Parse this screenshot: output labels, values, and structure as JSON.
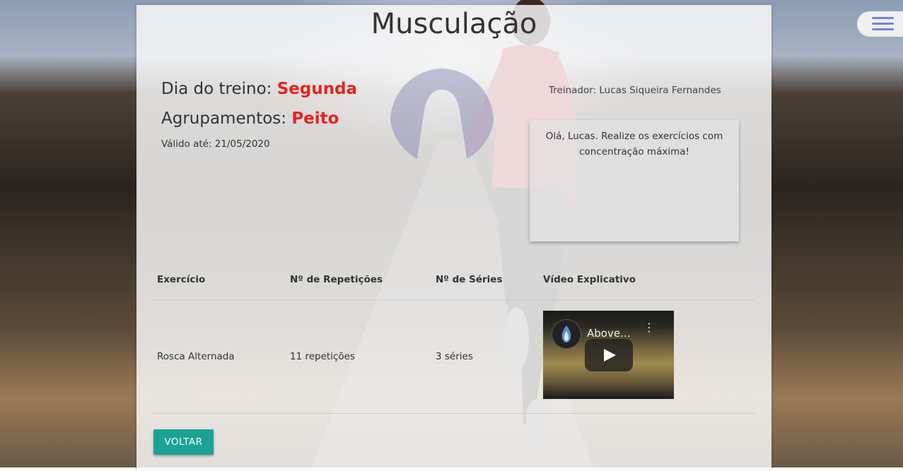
{
  "page": {
    "title": "Musculação"
  },
  "workout": {
    "day_label": "Dia do treino:",
    "day_value": "Segunda",
    "group_label": "Agrupamentos:",
    "group_value": "Peito",
    "valid_until": "Válido até: 21/05/2020"
  },
  "trainer": {
    "text": "Treinador: Lucas Siqueira Fernandes",
    "message": "Olá, Lucas. Realize os exercícios com concentração máxima!"
  },
  "table": {
    "headers": [
      "Exercício",
      "Nº de Repetições",
      "Nº de Séries",
      "Vídeo Explicativo"
    ],
    "rows": [
      {
        "exercise": "Rosca Alternada",
        "reps": "11 repetições",
        "sets": "3 séries",
        "video_title": "Above..."
      }
    ]
  },
  "actions": {
    "back_label": "VOLTAR"
  },
  "colors": {
    "accent_red": "#e3251f",
    "button_teal": "#1aa394",
    "menu_purple": "#7b7fd6"
  }
}
